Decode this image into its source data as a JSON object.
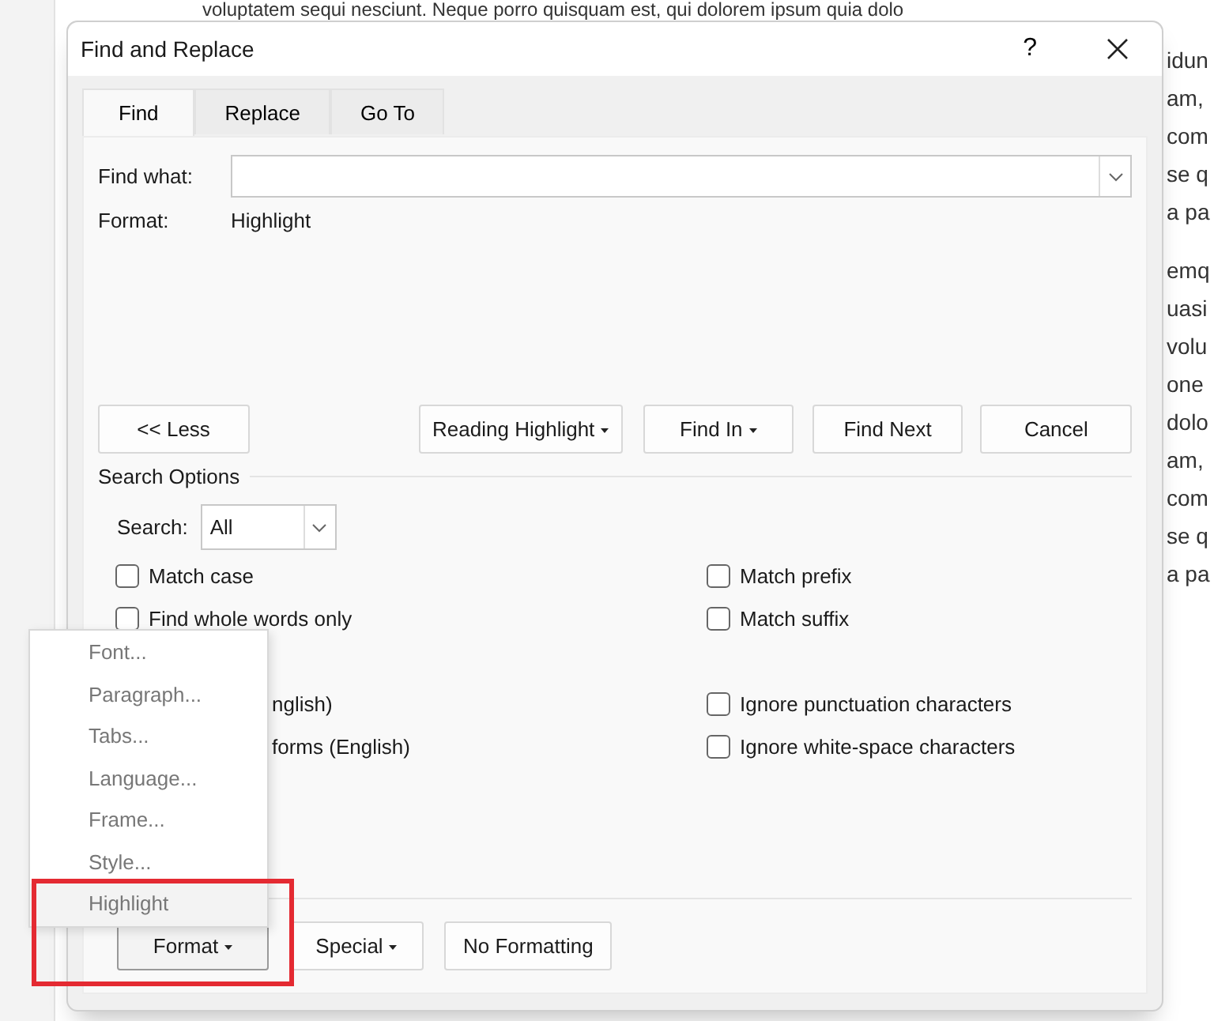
{
  "document": {
    "top_line": "voluptatem sequi nesciunt. Neque porro quisquam est, qui dolorem ipsum quia dolo",
    "paragraphs": [
      [
        "idun",
        "am,",
        "com",
        "se q",
        "a pa"
      ],
      [
        "emq",
        "uasi",
        "volu",
        "one",
        "dolo",
        "am,",
        "com",
        "se q",
        "a pa"
      ]
    ]
  },
  "window": {
    "title": "Find and Replace",
    "help": "?"
  },
  "tabs": [
    {
      "label": "Find",
      "selected": true
    },
    {
      "label": "Replace",
      "selected": false
    },
    {
      "label": "Go To",
      "selected": false
    }
  ],
  "find_what": {
    "label": "Find what:"
  },
  "format": {
    "label": "Format:",
    "value": "Highlight"
  },
  "buttons": [
    {
      "label": "<< Less",
      "dropdown": false
    },
    {
      "label": "Reading Highlight",
      "dropdown": true
    },
    {
      "label": "Find In",
      "dropdown": true
    },
    {
      "label": "Find Next",
      "dropdown": false
    },
    {
      "label": "Cancel",
      "dropdown": false
    }
  ],
  "search_options": {
    "title": "Search Options",
    "search_label": "Search:",
    "search_value": "All",
    "left": [
      {
        "kind": "checkbox",
        "label": "Match case",
        "checked": false
      },
      {
        "kind": "checkbox",
        "label": "Find whole words only",
        "checked": false
      },
      {
        "kind": "blank"
      },
      {
        "kind": "fragment",
        "label": "nglish)"
      },
      {
        "kind": "fragment",
        "label": "forms (English)"
      }
    ],
    "right": [
      {
        "kind": "checkbox",
        "label": "Match prefix",
        "checked": false
      },
      {
        "kind": "checkbox",
        "label": "Match suffix",
        "checked": false
      },
      {
        "kind": "blank"
      },
      {
        "kind": "checkbox",
        "label": "Ignore punctuation characters",
        "checked": false
      },
      {
        "kind": "checkbox",
        "label": "Ignore white-space characters",
        "checked": false
      }
    ]
  },
  "bottom_buttons": [
    {
      "label": "Format",
      "dropdown": true,
      "pressed": true
    },
    {
      "label": "Special",
      "dropdown": true,
      "pressed": false
    },
    {
      "label": "No Formatting",
      "dropdown": false,
      "pressed": false
    }
  ],
  "format_menu": [
    {
      "label": "Font...",
      "selected": false
    },
    {
      "label": "Paragraph...",
      "selected": false
    },
    {
      "label": "Tabs...",
      "selected": false
    },
    {
      "label": "Language...",
      "selected": false
    },
    {
      "label": "Frame...",
      "selected": false
    },
    {
      "label": "Style...",
      "selected": false
    },
    {
      "label": "Highlight",
      "selected": true
    }
  ]
}
